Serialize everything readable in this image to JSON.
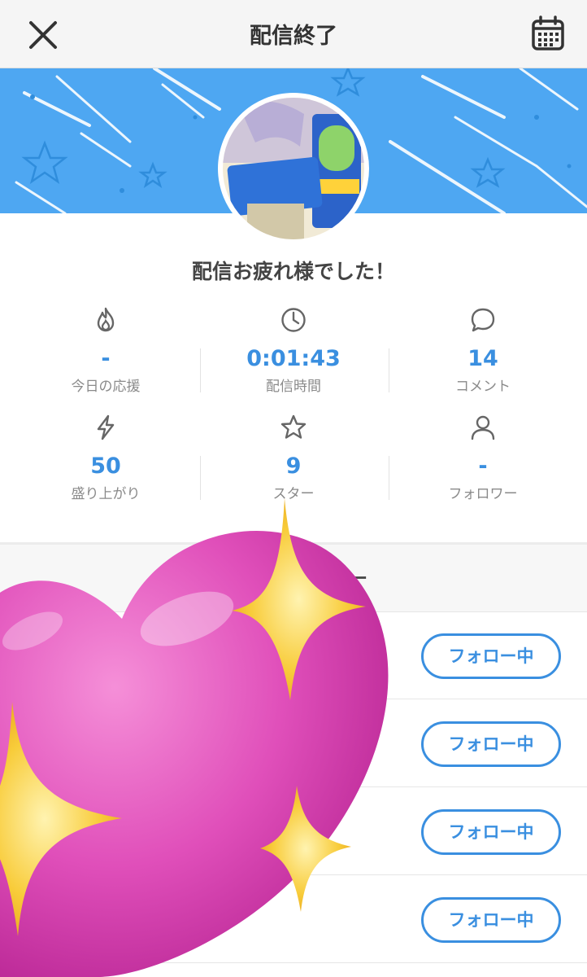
{
  "header": {
    "title": "配信終了"
  },
  "greeting": "配信お疲れ様でした！",
  "stats": [
    {
      "icon": "flame-icon",
      "value": "-",
      "label": "今日の応援"
    },
    {
      "icon": "clock-icon",
      "value": "0:01:43",
      "label": "配信時間"
    },
    {
      "icon": "comment-icon",
      "value": "14",
      "label": "コメント"
    },
    {
      "icon": "bolt-icon",
      "value": "50",
      "label": "盛り上がり"
    },
    {
      "icon": "star-icon",
      "value": "9",
      "label": "スター"
    },
    {
      "icon": "person-icon",
      "value": "-",
      "label": "フォロワー"
    }
  ],
  "list": {
    "section_title": "ー",
    "follow_buttons": [
      "フォロー中",
      "フォロー中",
      "フォロー中",
      "フォロー中"
    ]
  },
  "colors": {
    "accent": "#3a8fe0",
    "banner": "#4ea7f2",
    "sticker_heart": "#e048b8",
    "sticker_sparkle": "#f6c23a"
  }
}
